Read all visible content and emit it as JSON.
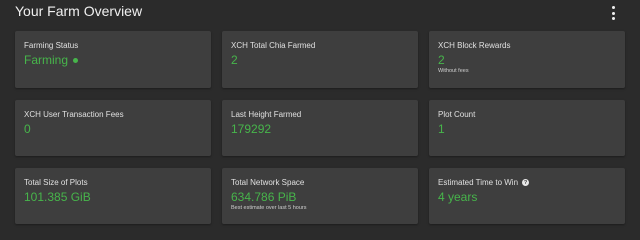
{
  "header": {
    "title": "Your Farm Overview",
    "menu_icon": "more-vertical-icon"
  },
  "colors": {
    "background": "#2b2b2b",
    "card": "#3e3e3e",
    "accent_green": "#47b54b"
  },
  "cards": {
    "farming_status": {
      "label": "Farming Status",
      "value": "Farming",
      "status_icon": "status-dot-icon"
    },
    "total_chia_farmed": {
      "label": "XCH Total Chia Farmed",
      "value": "2"
    },
    "block_rewards": {
      "label": "XCH Block Rewards",
      "value": "2",
      "note": "Without fees"
    },
    "user_transaction_fees": {
      "label": "XCH User Transaction Fees",
      "value": "0"
    },
    "last_height_farmed": {
      "label": "Last Height Farmed",
      "value": "179292"
    },
    "plot_count": {
      "label": "Plot Count",
      "value": "1"
    },
    "total_size_of_plots": {
      "label": "Total Size of Plots",
      "value": "101.385 GiB"
    },
    "total_network_space": {
      "label": "Total Network Space",
      "value": "634.786 PiB",
      "note": "Best estimate over last 5 hours"
    },
    "estimated_time_to_win": {
      "label": "Estimated Time to Win",
      "value": "4 years",
      "help_icon": "help-icon",
      "help_glyph": "?"
    }
  }
}
